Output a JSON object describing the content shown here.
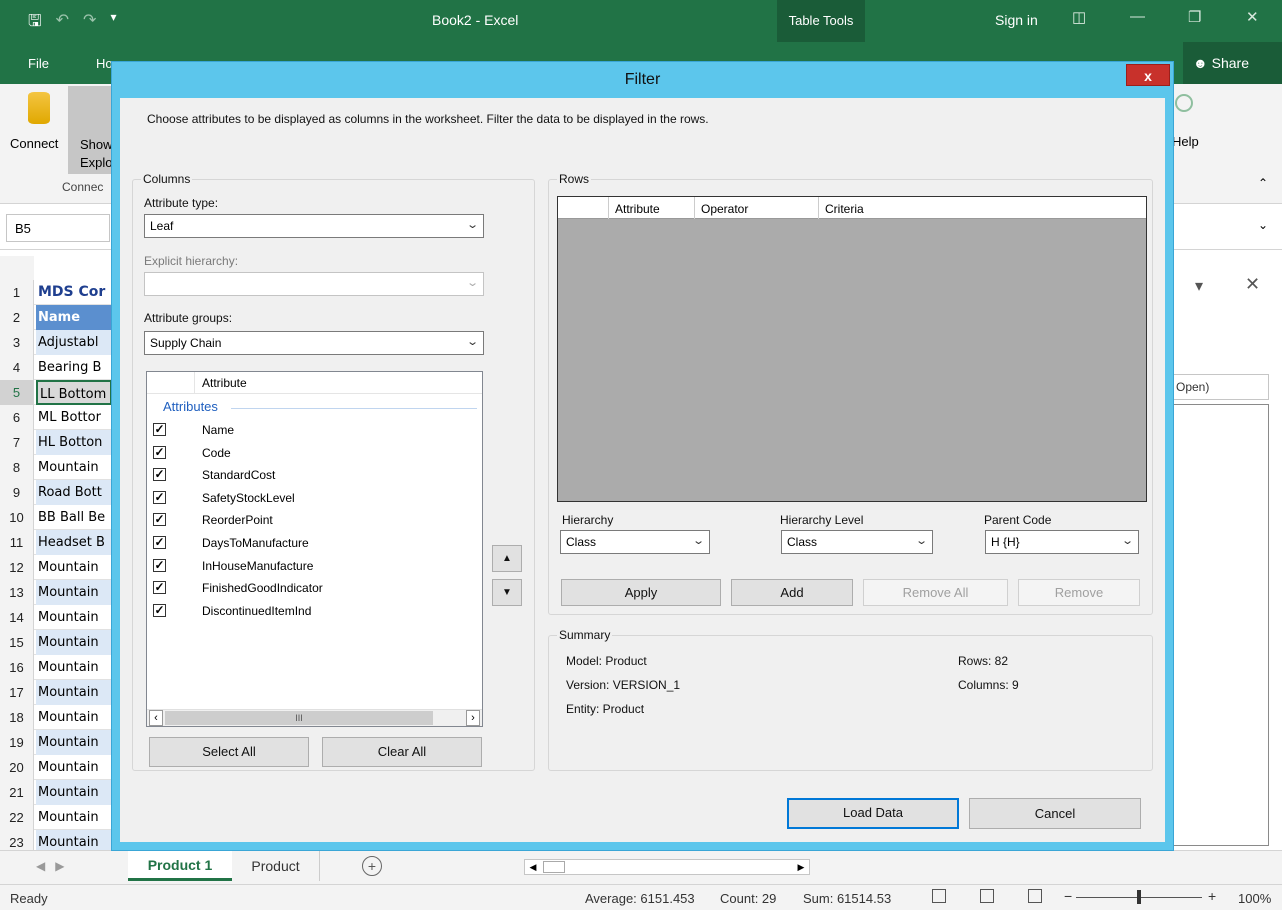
{
  "excel": {
    "window_title": "Book2 - Excel",
    "table_tools": "Table Tools",
    "sign_in": "Sign in",
    "share": "Share",
    "file_tab": "File",
    "home_tab_partial": "Ho",
    "ribbon": {
      "connect_label": "Connect",
      "show_label_1": "Show",
      "show_label_2": "Explor",
      "group_label": "Connec",
      "help_label": "Help"
    },
    "name_box": "B5",
    "rows": [
      {
        "num": "1",
        "text": "MDS Cor",
        "style": "hdr1"
      },
      {
        "num": "2",
        "text": "Name",
        "style": "hdr2"
      },
      {
        "num": "3",
        "text": "Adjustabl",
        "style": "light"
      },
      {
        "num": "4",
        "text": "Bearing B",
        "style": ""
      },
      {
        "num": "5",
        "text": "LL Bottom",
        "style": "selc"
      },
      {
        "num": "6",
        "text": "ML Bottor",
        "style": ""
      },
      {
        "num": "7",
        "text": "HL Botton",
        "style": "light"
      },
      {
        "num": "8",
        "text": "Mountain",
        "style": ""
      },
      {
        "num": "9",
        "text": "Road Bott",
        "style": "light"
      },
      {
        "num": "10",
        "text": "BB Ball Be",
        "style": ""
      },
      {
        "num": "11",
        "text": "Headset B",
        "style": "light"
      },
      {
        "num": "12",
        "text": "Mountain",
        "style": ""
      },
      {
        "num": "13",
        "text": "Mountain",
        "style": "light"
      },
      {
        "num": "14",
        "text": "Mountain",
        "style": ""
      },
      {
        "num": "15",
        "text": "Mountain",
        "style": "light"
      },
      {
        "num": "16",
        "text": "Mountain",
        "style": ""
      },
      {
        "num": "17",
        "text": "Mountain",
        "style": "light"
      },
      {
        "num": "18",
        "text": "Mountain",
        "style": ""
      },
      {
        "num": "19",
        "text": "Mountain",
        "style": "light"
      },
      {
        "num": "20",
        "text": "Mountain",
        "style": ""
      },
      {
        "num": "21",
        "text": "Mountain",
        "style": "light"
      },
      {
        "num": "22",
        "text": "Mountain",
        "style": ""
      },
      {
        "num": "23",
        "text": "Mountain",
        "style": "light"
      }
    ],
    "right_pane_combo": "Open)",
    "sheet_tabs": [
      "Product 1",
      "Product"
    ],
    "status": {
      "ready": "Ready",
      "average": "Average: 6151.453",
      "count": "Count: 29",
      "sum": "Sum: 61514.53",
      "zoom": "100%"
    }
  },
  "dialog": {
    "title": "Filter",
    "close": "x",
    "instructions": "Choose attributes to be displayed as columns in the worksheet. Filter the data to be displayed in the rows.",
    "columns": {
      "group_label": "Columns",
      "attribute_type_label": "Attribute type:",
      "attribute_type_value": "Leaf",
      "explicit_hierarchy_label": "Explicit hierarchy:",
      "explicit_hierarchy_value": "",
      "attribute_groups_label": "Attribute groups:",
      "attribute_groups_value": "Supply Chain",
      "list_header": "Attribute",
      "list_group": "Attributes",
      "attributes": [
        {
          "name": "Name",
          "checked": true
        },
        {
          "name": "Code",
          "checked": true
        },
        {
          "name": "StandardCost",
          "checked": true
        },
        {
          "name": "SafetyStockLevel",
          "checked": true
        },
        {
          "name": "ReorderPoint",
          "checked": true
        },
        {
          "name": "DaysToManufacture",
          "checked": true
        },
        {
          "name": "InHouseManufacture",
          "checked": true
        },
        {
          "name": "FinishedGoodIndicator",
          "checked": true
        },
        {
          "name": "DiscontinuedItemInd",
          "checked": true
        }
      ],
      "select_all": "Select All",
      "clear_all": "Clear All"
    },
    "rows": {
      "group_label": "Rows",
      "grid_headers": [
        "Attribute",
        "Operator",
        "Criteria"
      ],
      "hierarchy_label": "Hierarchy",
      "hierarchy_value": "Class",
      "hierarchy_level_label": "Hierarchy Level",
      "hierarchy_level_value": "Class",
      "parent_code_label": "Parent Code",
      "parent_code_value": "H {H}",
      "apply": "Apply",
      "add": "Add",
      "remove_all": "Remove All",
      "remove": "Remove"
    },
    "summary": {
      "group_label": "Summary",
      "model": "Model: Product",
      "version": "Version: VERSION_1",
      "entity": "Entity: Product",
      "rows": "Rows: 82",
      "columns": "Columns: 9"
    },
    "load_data": "Load Data",
    "cancel": "Cancel"
  },
  "colors": {
    "excel_green": "#217346",
    "dialog_frame": "#5cc6ec",
    "close_red": "#c8312b",
    "grid_gray": "#ababab"
  }
}
